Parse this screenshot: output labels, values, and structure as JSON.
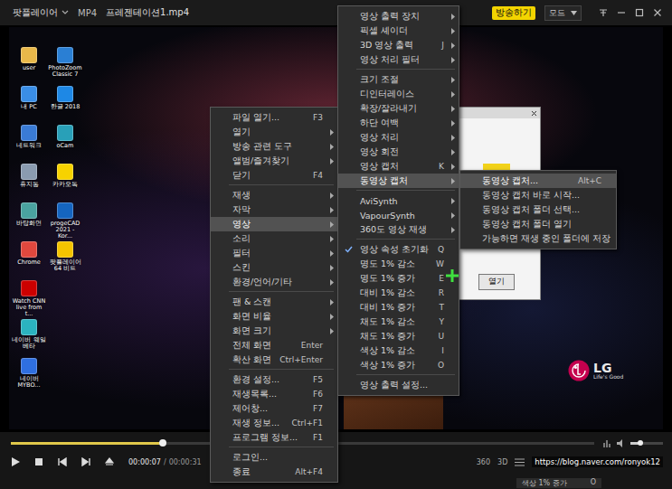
{
  "titlebar": {
    "app": "팟플레이어",
    "format": "MP4",
    "file": "프레젠테이션1.mp4",
    "broadcast": "방송하기",
    "mode": "모드"
  },
  "desktop": {
    "columns": [
      [
        {
          "label": "user",
          "color": "#e8b84a"
        },
        {
          "label": "내 PC",
          "color": "#3a8ee6"
        },
        {
          "label": "네트워크",
          "color": "#3a7bd5"
        },
        {
          "label": "휴지통",
          "color": "#8a9bb0"
        },
        {
          "label": "바탕화면",
          "color": "#4aa3a0"
        },
        {
          "label": "Chrome",
          "color": "#e0483e"
        },
        {
          "label": "Watch CNN live from t...",
          "color": "#cc0000"
        },
        {
          "label": "네이버 웨일 베타",
          "color": "#2bb3c0"
        },
        {
          "label": "네이버 MYBO...",
          "color": "#2f6fe0"
        }
      ],
      [
        {
          "label": "PhotoZoom Classic 7",
          "color": "#2a7fd4"
        },
        {
          "label": "한글 2018",
          "color": "#1e88e5"
        },
        {
          "label": "oCam",
          "color": "#29a0b8"
        },
        {
          "label": "카카오톡",
          "color": "#f7d200"
        },
        {
          "label": "progeCAD 2021 - Kor...",
          "color": "#1565c0"
        },
        {
          "label": "팟플레이어 64 비트",
          "color": "#f5c400"
        }
      ]
    ]
  },
  "dialog": {
    "button": "열기"
  },
  "logo": {
    "brand": "LG",
    "slogan": "Life's Good"
  },
  "menus": [
    {
      "items": [
        {
          "kind": "item",
          "label": "파일 열기...",
          "shortcut": "F3",
          "submenu": false,
          "selected": false,
          "checked": false
        },
        {
          "kind": "item",
          "label": "열기",
          "shortcut": "",
          "submenu": true,
          "selected": false,
          "checked": false
        },
        {
          "kind": "item",
          "label": "방송 관련 도구",
          "shortcut": "",
          "submenu": true,
          "selected": false,
          "checked": false
        },
        {
          "kind": "item",
          "label": "앨범/즐겨찾기",
          "shortcut": "",
          "submenu": true,
          "selected": false,
          "checked": false
        },
        {
          "kind": "item",
          "label": "닫기",
          "shortcut": "F4",
          "submenu": false,
          "selected": false,
          "checked": false
        },
        {
          "kind": "separator"
        },
        {
          "kind": "item",
          "label": "재생",
          "shortcut": "",
          "submenu": true,
          "selected": false,
          "checked": false
        },
        {
          "kind": "item",
          "label": "자막",
          "shortcut": "",
          "submenu": true,
          "selected": false,
          "checked": false
        },
        {
          "kind": "item",
          "label": "영상",
          "shortcut": "",
          "submenu": true,
          "selected": true,
          "checked": false
        },
        {
          "kind": "item",
          "label": "소리",
          "shortcut": "",
          "submenu": true,
          "selected": false,
          "checked": false
        },
        {
          "kind": "item",
          "label": "필터",
          "shortcut": "",
          "submenu": true,
          "selected": false,
          "checked": false
        },
        {
          "kind": "item",
          "label": "스킨",
          "shortcut": "",
          "submenu": true,
          "selected": false,
          "checked": false
        },
        {
          "kind": "item",
          "label": "환경/언어/기타",
          "shortcut": "",
          "submenu": true,
          "selected": false,
          "checked": false
        },
        {
          "kind": "separator"
        },
        {
          "kind": "item",
          "label": "팬 & 스캔",
          "shortcut": "",
          "submenu": true,
          "selected": false,
          "checked": false
        },
        {
          "kind": "item",
          "label": "화면 비율",
          "shortcut": "",
          "submenu": true,
          "selected": false,
          "checked": false
        },
        {
          "kind": "item",
          "label": "화면 크기",
          "shortcut": "",
          "submenu": true,
          "selected": false,
          "checked": false
        },
        {
          "kind": "item",
          "label": "전체 화면",
          "shortcut": "Enter",
          "submenu": false,
          "selected": false,
          "checked": false
        },
        {
          "kind": "item",
          "label": "확산 화면",
          "shortcut": "Ctrl+Enter",
          "submenu": false,
          "selected": false,
          "checked": false
        },
        {
          "kind": "separator"
        },
        {
          "kind": "item",
          "label": "환경 설정...",
          "shortcut": "F5",
          "submenu": false,
          "selected": false,
          "checked": false
        },
        {
          "kind": "item",
          "label": "재생목록...",
          "shortcut": "F6",
          "submenu": false,
          "selected": false,
          "checked": false
        },
        {
          "kind": "item",
          "label": "제어창...",
          "shortcut": "F7",
          "submenu": false,
          "selected": false,
          "checked": false
        },
        {
          "kind": "item",
          "label": "재생 정보...",
          "shortcut": "Ctrl+F1",
          "submenu": false,
          "selected": false,
          "checked": false
        },
        {
          "kind": "item",
          "label": "프로그램 정보...",
          "shortcut": "F1",
          "submenu": false,
          "selected": false,
          "checked": false
        },
        {
          "kind": "separator"
        },
        {
          "kind": "item",
          "label": "로그인...",
          "shortcut": "",
          "submenu": false,
          "selected": false,
          "checked": false
        },
        {
          "kind": "item",
          "label": "종료",
          "shortcut": "Alt+F4",
          "submenu": false,
          "selected": false,
          "checked": false
        }
      ]
    },
    {
      "items": [
        {
          "kind": "item",
          "label": "영상 출력 장치",
          "shortcut": "",
          "submenu": true,
          "selected": false,
          "checked": false
        },
        {
          "kind": "item",
          "label": "픽셀 셰이더",
          "shortcut": "",
          "submenu": true,
          "selected": false,
          "checked": false
        },
        {
          "kind": "item",
          "label": "3D 영상 출력",
          "shortcut": "J",
          "submenu": true,
          "selected": false,
          "checked": false
        },
        {
          "kind": "item",
          "label": "영상 처리 필터",
          "shortcut": "",
          "submenu": true,
          "selected": false,
          "checked": false
        },
        {
          "kind": "separator"
        },
        {
          "kind": "item",
          "label": "크기 조절",
          "shortcut": "",
          "submenu": true,
          "selected": false,
          "checked": false
        },
        {
          "kind": "item",
          "label": "디인터레이스",
          "shortcut": "",
          "submenu": true,
          "selected": false,
          "checked": false
        },
        {
          "kind": "item",
          "label": "확장/잘라내기",
          "shortcut": "",
          "submenu": true,
          "selected": false,
          "checked": false
        },
        {
          "kind": "item",
          "label": "하단 여백",
          "shortcut": "",
          "submenu": true,
          "selected": false,
          "checked": false
        },
        {
          "kind": "item",
          "label": "영상 처리",
          "shortcut": "",
          "submenu": true,
          "selected": false,
          "checked": false
        },
        {
          "kind": "item",
          "label": "영상 회전",
          "shortcut": "",
          "submenu": true,
          "selected": false,
          "checked": false
        },
        {
          "kind": "item",
          "label": "영상 캡처",
          "shortcut": "K",
          "submenu": true,
          "selected": false,
          "checked": false
        },
        {
          "kind": "item",
          "label": "동영상 캡처",
          "shortcut": "",
          "submenu": true,
          "selected": true,
          "checked": false
        },
        {
          "kind": "separator"
        },
        {
          "kind": "item",
          "label": "AviSynth",
          "shortcut": "",
          "submenu": true,
          "selected": false,
          "checked": false
        },
        {
          "kind": "item",
          "label": "VapourSynth",
          "shortcut": "",
          "submenu": true,
          "selected": false,
          "checked": false
        },
        {
          "kind": "item",
          "label": "360도 영상 재생",
          "shortcut": "",
          "submenu": true,
          "selected": false,
          "checked": false
        },
        {
          "kind": "separator"
        },
        {
          "kind": "item",
          "label": "영상 속성 초기화",
          "shortcut": "Q",
          "submenu": false,
          "selected": false,
          "checked": true
        },
        {
          "kind": "item",
          "label": "명도 1% 감소",
          "shortcut": "W",
          "submenu": false,
          "selected": false,
          "checked": false
        },
        {
          "kind": "item",
          "label": "명도 1% 증가",
          "shortcut": "E",
          "submenu": false,
          "selected": false,
          "checked": false
        },
        {
          "kind": "item",
          "label": "대비 1% 감소",
          "shortcut": "R",
          "submenu": false,
          "selected": false,
          "checked": false
        },
        {
          "kind": "item",
          "label": "대비 1% 증가",
          "shortcut": "T",
          "submenu": false,
          "selected": false,
          "checked": false
        },
        {
          "kind": "item",
          "label": "채도 1% 감소",
          "shortcut": "Y",
          "submenu": false,
          "selected": false,
          "checked": false
        },
        {
          "kind": "item",
          "label": "채도 1% 증가",
          "shortcut": "U",
          "submenu": false,
          "selected": false,
          "checked": false
        },
        {
          "kind": "item",
          "label": "색상 1% 감소",
          "shortcut": "I",
          "submenu": false,
          "selected": false,
          "checked": false
        },
        {
          "kind": "item",
          "label": "색상 1% 증가",
          "shortcut": "O",
          "submenu": false,
          "selected": false,
          "checked": false
        },
        {
          "kind": "separator"
        },
        {
          "kind": "item",
          "label": "영상 출력 설정...",
          "shortcut": "",
          "submenu": false,
          "selected": false,
          "checked": false
        }
      ]
    },
    {
      "items": [
        {
          "kind": "item",
          "label": "동영상 캡처...",
          "shortcut": "Alt+C",
          "submenu": false,
          "selected": true,
          "checked": false
        },
        {
          "kind": "item",
          "label": "동영상 캡처 바로 시작...",
          "shortcut": "",
          "submenu": false,
          "selected": false,
          "checked": false
        },
        {
          "kind": "item",
          "label": "동영상 캡처 폴더 선택...",
          "shortcut": "",
          "submenu": false,
          "selected": false,
          "checked": false
        },
        {
          "kind": "item",
          "label": "동영상 캡처 폴더 열기",
          "shortcut": "",
          "submenu": false,
          "selected": false,
          "checked": false
        },
        {
          "kind": "item",
          "label": "가능하면 재생 중인 폴더에 저장",
          "shortcut": "",
          "submenu": false,
          "selected": false,
          "checked": false
        }
      ]
    }
  ],
  "controls": {
    "seek": {
      "level": 0.26
    },
    "position": "00:00:07",
    "separator": "/",
    "duration": "00:00:31",
    "volume": {
      "level": 0.3
    },
    "modes": [
      "360",
      "3D"
    ]
  },
  "watermark": "https://blog.naver.com/ronyok12",
  "osd": {
    "label": "색상 1% 증가",
    "key": "O"
  }
}
